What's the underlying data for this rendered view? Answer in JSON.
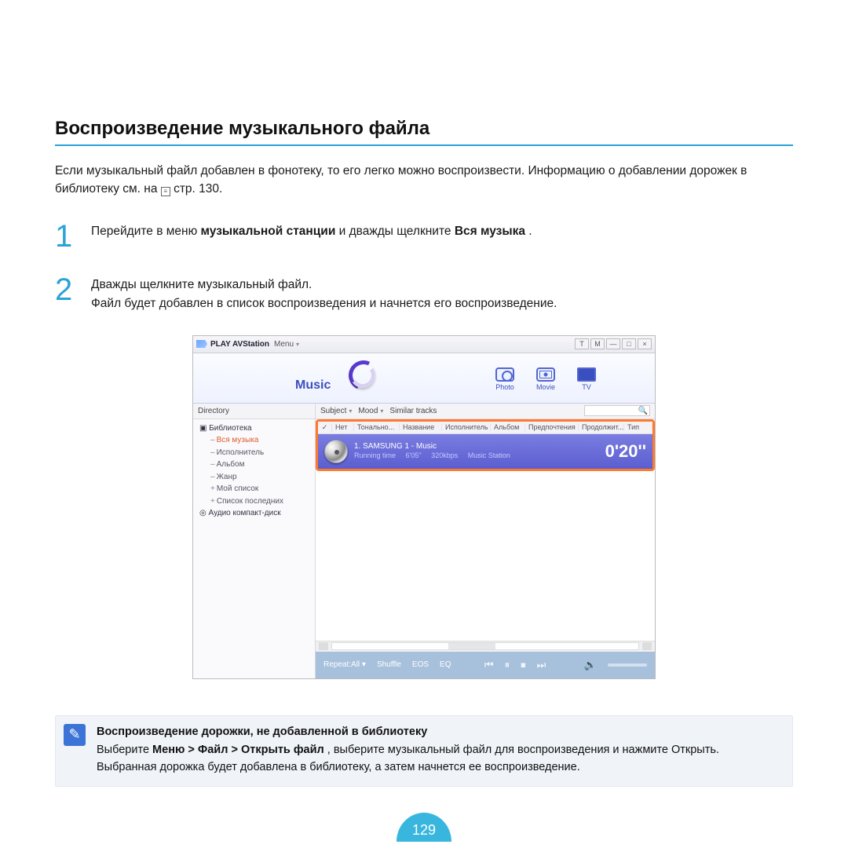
{
  "section_title": "Воспроизведение музыкального файла",
  "intro_pre": "Если музыкальный файл добавлен в фонотеку, то его легко можно воспроизвести. Информацию о добавлении дорожек в библиотеку см. на ",
  "intro_post": " стр. 130.",
  "steps": {
    "s1": {
      "num": "1",
      "pre": "Перейдите в меню ",
      "bold1": "музыкальной станции",
      "mid": " и дважды щелкните ",
      "bold2": "Вся музыка",
      "post": "."
    },
    "s2": {
      "num": "2",
      "line1": "Дважды щелкните музыкальный файл.",
      "line2": "Файл будет добавлен в список воспроизведения и начнется его воспроизведение."
    }
  },
  "app": {
    "title": "PLAY AVStation",
    "menu": "Menu",
    "win_btns": {
      "t": "T",
      "m": "M",
      "min": "―",
      "max": "□",
      "close": "×"
    },
    "music_label": "Music",
    "tabs": {
      "photo": "Photo",
      "movie": "Movie",
      "tv": "TV"
    },
    "directory_label": "Directory",
    "tree": {
      "library": "Библиотека",
      "all_music": "Вся музыка",
      "artist": "Исполнитель",
      "album": "Альбом",
      "genre": "Жанр",
      "mylist": "Мой список",
      "recent": "Список последних",
      "audio_cd": "Аудио компакт-диск"
    },
    "filters": {
      "subject": "Subject",
      "mood": "Mood",
      "similar": "Similar tracks"
    },
    "cols": {
      "chk": "✓",
      "no": "Нет",
      "tone": "Тонально...",
      "name": "Название",
      "artist": "Исполнитель",
      "album": "Альбом",
      "pref": "Предпочтения",
      "dur": "Продолжит...",
      "type": "Тип"
    },
    "track": {
      "title": "1.  SAMSUNG 1 - Music",
      "rt_lbl": "Running time",
      "rt": "6'05''",
      "br": "320kbps",
      "src": "Music Station",
      "time": "0'20''"
    },
    "footer": {
      "repeat": "Repeat:All",
      "shuffle": "Shuffle",
      "eos": "EOS",
      "eq": "EQ"
    }
  },
  "note": {
    "title": "Воспроизведение дорожки, не добавленной в библиотеку",
    "pre": "Выберите ",
    "bold": "Меню > Файл > Открыть файл",
    "mid": ", выберите музыкальный файл для воспроизведения и нажмите Открыть.",
    "line2": "Выбранная дорожка будет добавлена в библиотеку, а затем начнется ее воспроизведение."
  },
  "page_number": "129"
}
